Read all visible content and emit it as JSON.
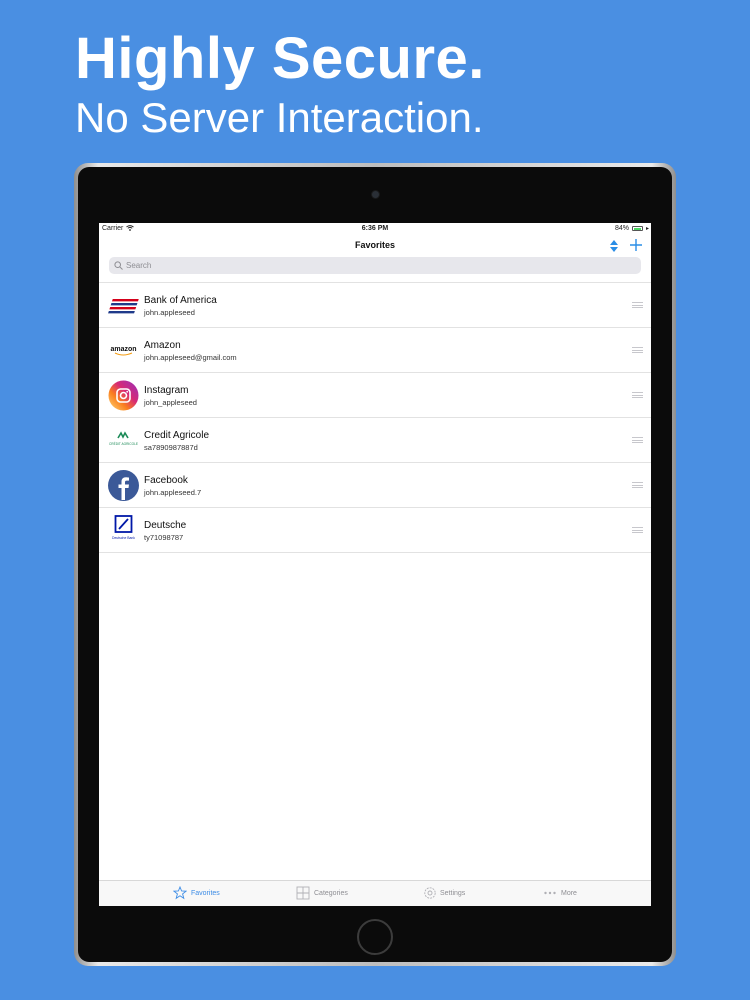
{
  "promo": {
    "headline": "Highly Secure.",
    "subline": "No Server Interaction."
  },
  "status_bar": {
    "carrier": "Carrier",
    "time": "6:36 PM",
    "battery": "84%"
  },
  "nav": {
    "title": "Favorites",
    "accent_color": "#2a8de6"
  },
  "search": {
    "placeholder": "Search"
  },
  "favorites": [
    {
      "name": "Bank of America",
      "username": "john.appleseed",
      "icon": "bank-of-america-logo"
    },
    {
      "name": "Amazon",
      "username": "john.appleseed@gmail.com",
      "icon": "amazon-logo"
    },
    {
      "name": "Instagram",
      "username": "john_appleseed",
      "icon": "instagram-logo"
    },
    {
      "name": "Credit Agricole",
      "username": "sa7890987887d",
      "icon": "credit-agricole-logo"
    },
    {
      "name": "Facebook",
      "username": "john.appleseed.7",
      "icon": "facebook-logo"
    },
    {
      "name": "Deutsche",
      "username": "ty71098787",
      "icon": "deutsche-bank-logo"
    }
  ],
  "logo_text": {
    "amazon": "amazon",
    "credit_agricole": "CRÉDIT AGRICOLE",
    "deutsche": "Deutsche Bank"
  },
  "tabs": [
    {
      "label": "Favorites",
      "icon": "star-icon",
      "active": true
    },
    {
      "label": "Categories",
      "icon": "grid-icon",
      "active": false
    },
    {
      "label": "Settings",
      "icon": "gear-icon",
      "active": false
    },
    {
      "label": "More",
      "icon": "more-icon",
      "active": false
    }
  ]
}
